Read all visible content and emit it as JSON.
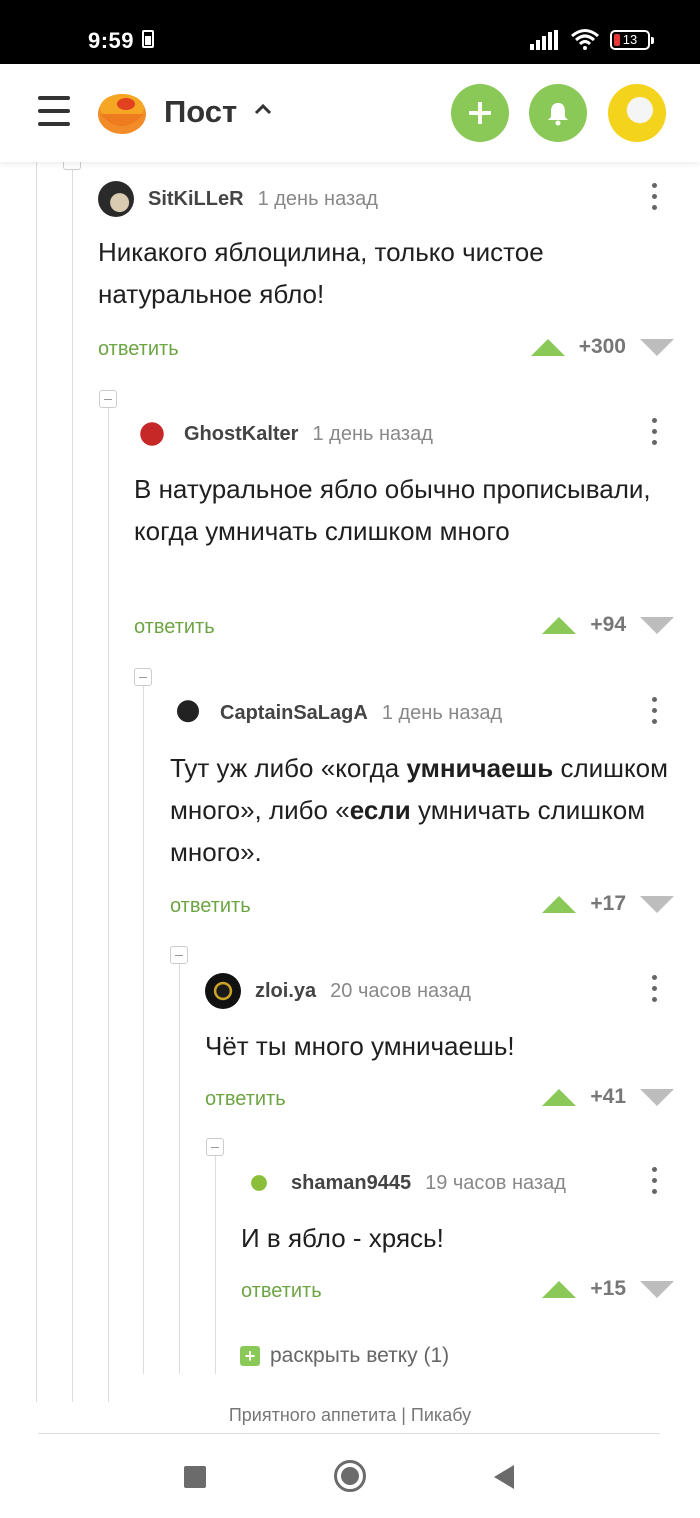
{
  "status_bar": {
    "time": "9:59",
    "battery_level": "13"
  },
  "header": {
    "title": "Пост",
    "colors": {
      "accent": "#8ac858"
    }
  },
  "comments": [
    {
      "user": "SitKiLLeR",
      "time": "1 день назад",
      "text": "Никакого яблоцилина, только чистое натуральное ябло!",
      "reply_label": "ответить",
      "score": "+300"
    },
    {
      "user": "GhostKalter",
      "time": "1 день назад",
      "text": "В натуральное ябло обычно прописывали, когда умничать слишком много",
      "reply_label": "ответить",
      "score": "+94"
    },
    {
      "user": "CaptainSaLagA",
      "time": "1 день назад",
      "text_parts": [
        "Тут уж либо «когда ",
        "умничаешь",
        " слишком много», либо «",
        "если",
        " умничать слишком много»."
      ],
      "reply_label": "ответить",
      "score": "+17"
    },
    {
      "user": "zloi.ya",
      "time": "20 часов назад",
      "text": "Чёт ты много умничаешь!",
      "reply_label": "ответить",
      "score": "+41"
    },
    {
      "user": "shaman9445",
      "time": "19 часов назад",
      "text": "И в ябло - хрясь!",
      "reply_label": "ответить",
      "score": "+15"
    }
  ],
  "expand_branch": {
    "label": "раскрыть ветку (1)"
  },
  "footer": {
    "text": "Приятного аппетита | Пикабу"
  }
}
